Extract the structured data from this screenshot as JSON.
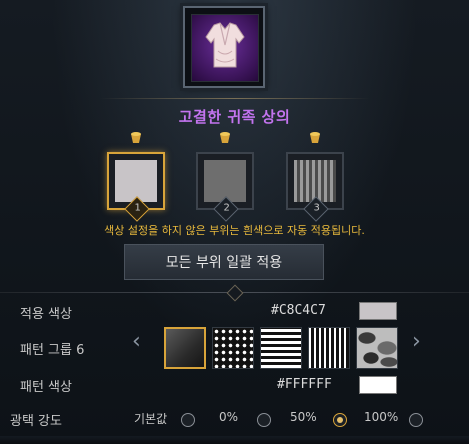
{
  "item": {
    "name": "고결한 귀족 상의",
    "icon": "noble-top-garment-icon",
    "icon_bg_color": "#4a1a6e",
    "name_color": "#c374ef"
  },
  "slots": [
    {
      "number": "1",
      "color": "#C8C4C7",
      "pattern": "solid",
      "active": true
    },
    {
      "number": "2",
      "color": "#6e6e6e",
      "pattern": "solid",
      "active": false
    },
    {
      "number": "3",
      "color": "#8a8a8a",
      "pattern": "vertical-stripes",
      "active": false
    }
  ],
  "notice": "색상 설정을 하지 않은 부위는 흰색으로 자동 적용됩니다.",
  "apply_all_button": "모든 부위 일괄 적용",
  "applied_color": {
    "label": "적용 색상",
    "hex": "#C8C4C7"
  },
  "pattern_group": {
    "label": "패턴 그룹 6",
    "patterns": [
      "gradient-dark",
      "dots",
      "horizontal-stripes",
      "vertical-stripes",
      "camouflage"
    ],
    "selected_index": 0
  },
  "pattern_color": {
    "label": "패턴 색상",
    "hex": "#FFFFFF"
  },
  "gloss": {
    "label": "광택 강도",
    "options": [
      "기본값",
      "0%",
      "50%",
      "100%"
    ],
    "selected_index": 2
  },
  "accent_color": "#d8a43a"
}
